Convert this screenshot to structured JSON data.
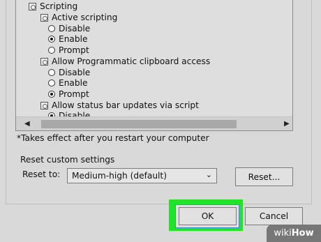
{
  "tree": {
    "rows": [
      {
        "kind": "group",
        "label": "Scripting"
      },
      {
        "kind": "group",
        "label": "Active scripting"
      },
      {
        "kind": "radio",
        "label": "Disable",
        "checked": false
      },
      {
        "kind": "radio",
        "label": "Enable",
        "checked": true
      },
      {
        "kind": "radio",
        "label": "Prompt",
        "checked": false
      },
      {
        "kind": "group",
        "label": "Allow Programmatic clipboard access"
      },
      {
        "kind": "radio",
        "label": "Disable",
        "checked": false
      },
      {
        "kind": "radio",
        "label": "Enable",
        "checked": false
      },
      {
        "kind": "radio",
        "label": "Prompt",
        "checked": true
      },
      {
        "kind": "group",
        "label": "Allow status bar updates via script"
      },
      {
        "kind": "radio",
        "label": "Disable",
        "checked": true
      }
    ]
  },
  "note": "*Takes effect after you restart your computer",
  "reset": {
    "section_label": "Reset custom settings",
    "reset_to_label": "Reset to:",
    "selected_level": "Medium-high (default)",
    "reset_button": "Reset..."
  },
  "buttons": {
    "ok": "OK",
    "cancel": "Cancel"
  },
  "watermark": {
    "part1": "wiki",
    "part2": "How"
  },
  "colors": {
    "highlight": "#22e22c"
  }
}
